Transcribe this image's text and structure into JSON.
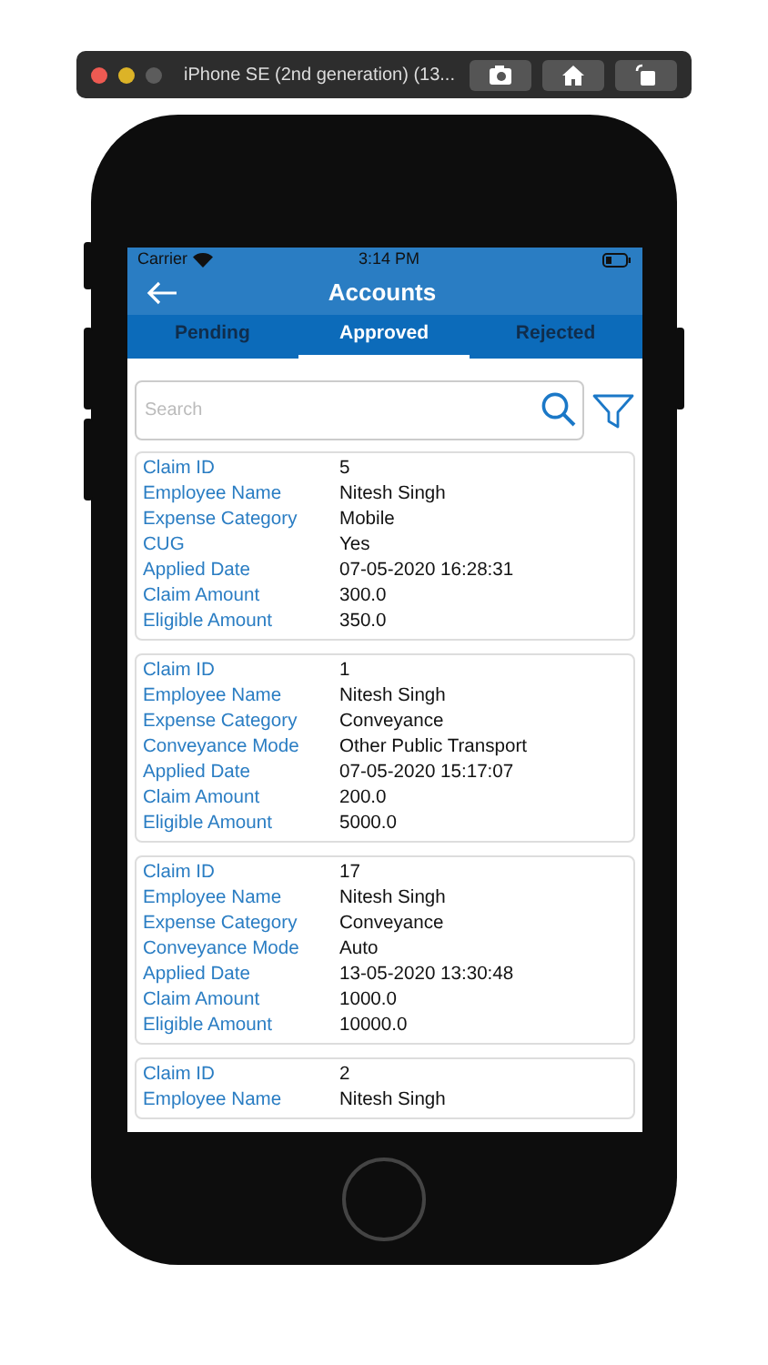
{
  "simulator": {
    "title": "iPhone SE (2nd generation) (13..."
  },
  "status_bar": {
    "carrier": "Carrier",
    "time": "3:14 PM"
  },
  "nav": {
    "title": "Accounts"
  },
  "tabs": [
    {
      "label": "Pending",
      "selected": false
    },
    {
      "label": "Approved",
      "selected": true
    },
    {
      "label": "Rejected",
      "selected": false
    }
  ],
  "search": {
    "placeholder": "Search"
  },
  "claims": [
    {
      "fields": [
        {
          "label": "Claim ID",
          "value": "5"
        },
        {
          "label": "Employee Name",
          "value": "Nitesh Singh"
        },
        {
          "label": "Expense Category",
          "value": "Mobile"
        },
        {
          "label": "CUG",
          "value": "Yes"
        },
        {
          "label": "Applied Date",
          "value": "07-05-2020 16:28:31"
        },
        {
          "label": "Claim Amount",
          "value": "300.0"
        },
        {
          "label": "Eligible Amount",
          "value": "350.0"
        }
      ]
    },
    {
      "fields": [
        {
          "label": "Claim ID",
          "value": "1"
        },
        {
          "label": "Employee Name",
          "value": "Nitesh Singh"
        },
        {
          "label": "Expense Category",
          "value": "Conveyance"
        },
        {
          "label": "Conveyance Mode",
          "value": "Other Public Transport"
        },
        {
          "label": "Applied Date",
          "value": "07-05-2020 15:17:07"
        },
        {
          "label": "Claim Amount",
          "value": "200.0"
        },
        {
          "label": "Eligible Amount",
          "value": "5000.0"
        }
      ]
    },
    {
      "fields": [
        {
          "label": "Claim ID",
          "value": "17"
        },
        {
          "label": "Employee Name",
          "value": "Nitesh Singh"
        },
        {
          "label": "Expense Category",
          "value": "Conveyance"
        },
        {
          "label": "Conveyance Mode",
          "value": "Auto"
        },
        {
          "label": "Applied Date",
          "value": "13-05-2020 13:30:48"
        },
        {
          "label": "Claim Amount",
          "value": "1000.0"
        },
        {
          "label": "Eligible Amount",
          "value": "10000.0"
        }
      ]
    },
    {
      "fields": [
        {
          "label": "Claim ID",
          "value": "2"
        },
        {
          "label": "Employee Name",
          "value": "Nitesh Singh"
        }
      ]
    }
  ]
}
